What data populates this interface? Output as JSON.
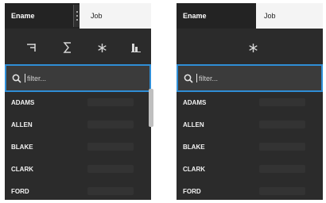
{
  "panels": [
    {
      "header": {
        "ename": "Ename",
        "job": "Job"
      },
      "search": {
        "placeholder": "filter..."
      },
      "rows": [
        {
          "ename": "ADAMS"
        },
        {
          "ename": "ALLEN"
        },
        {
          "ename": "BLAKE"
        },
        {
          "ename": "CLARK"
        },
        {
          "ename": "FORD"
        }
      ]
    },
    {
      "header": {
        "ename": "Ename",
        "job": "Job"
      },
      "search": {
        "placeholder": "filter..."
      },
      "rows": [
        {
          "ename": "ADAMS"
        },
        {
          "ename": "ALLEN"
        },
        {
          "ename": "BLAKE"
        },
        {
          "ename": "CLARK"
        },
        {
          "ename": "FORD"
        }
      ]
    }
  ],
  "icons": {
    "left_toolbar": [
      "sort-icon",
      "sum-icon",
      "freeze-icon",
      "chart-icon"
    ],
    "right_toolbar": [
      "freeze-icon"
    ]
  },
  "colors": {
    "panel_bg": "#2b2b2b",
    "header_dark": "#232323",
    "header_light": "#f4f4f4",
    "search_border": "#2f8ed6",
    "search_bg": "#3b3b3b"
  }
}
